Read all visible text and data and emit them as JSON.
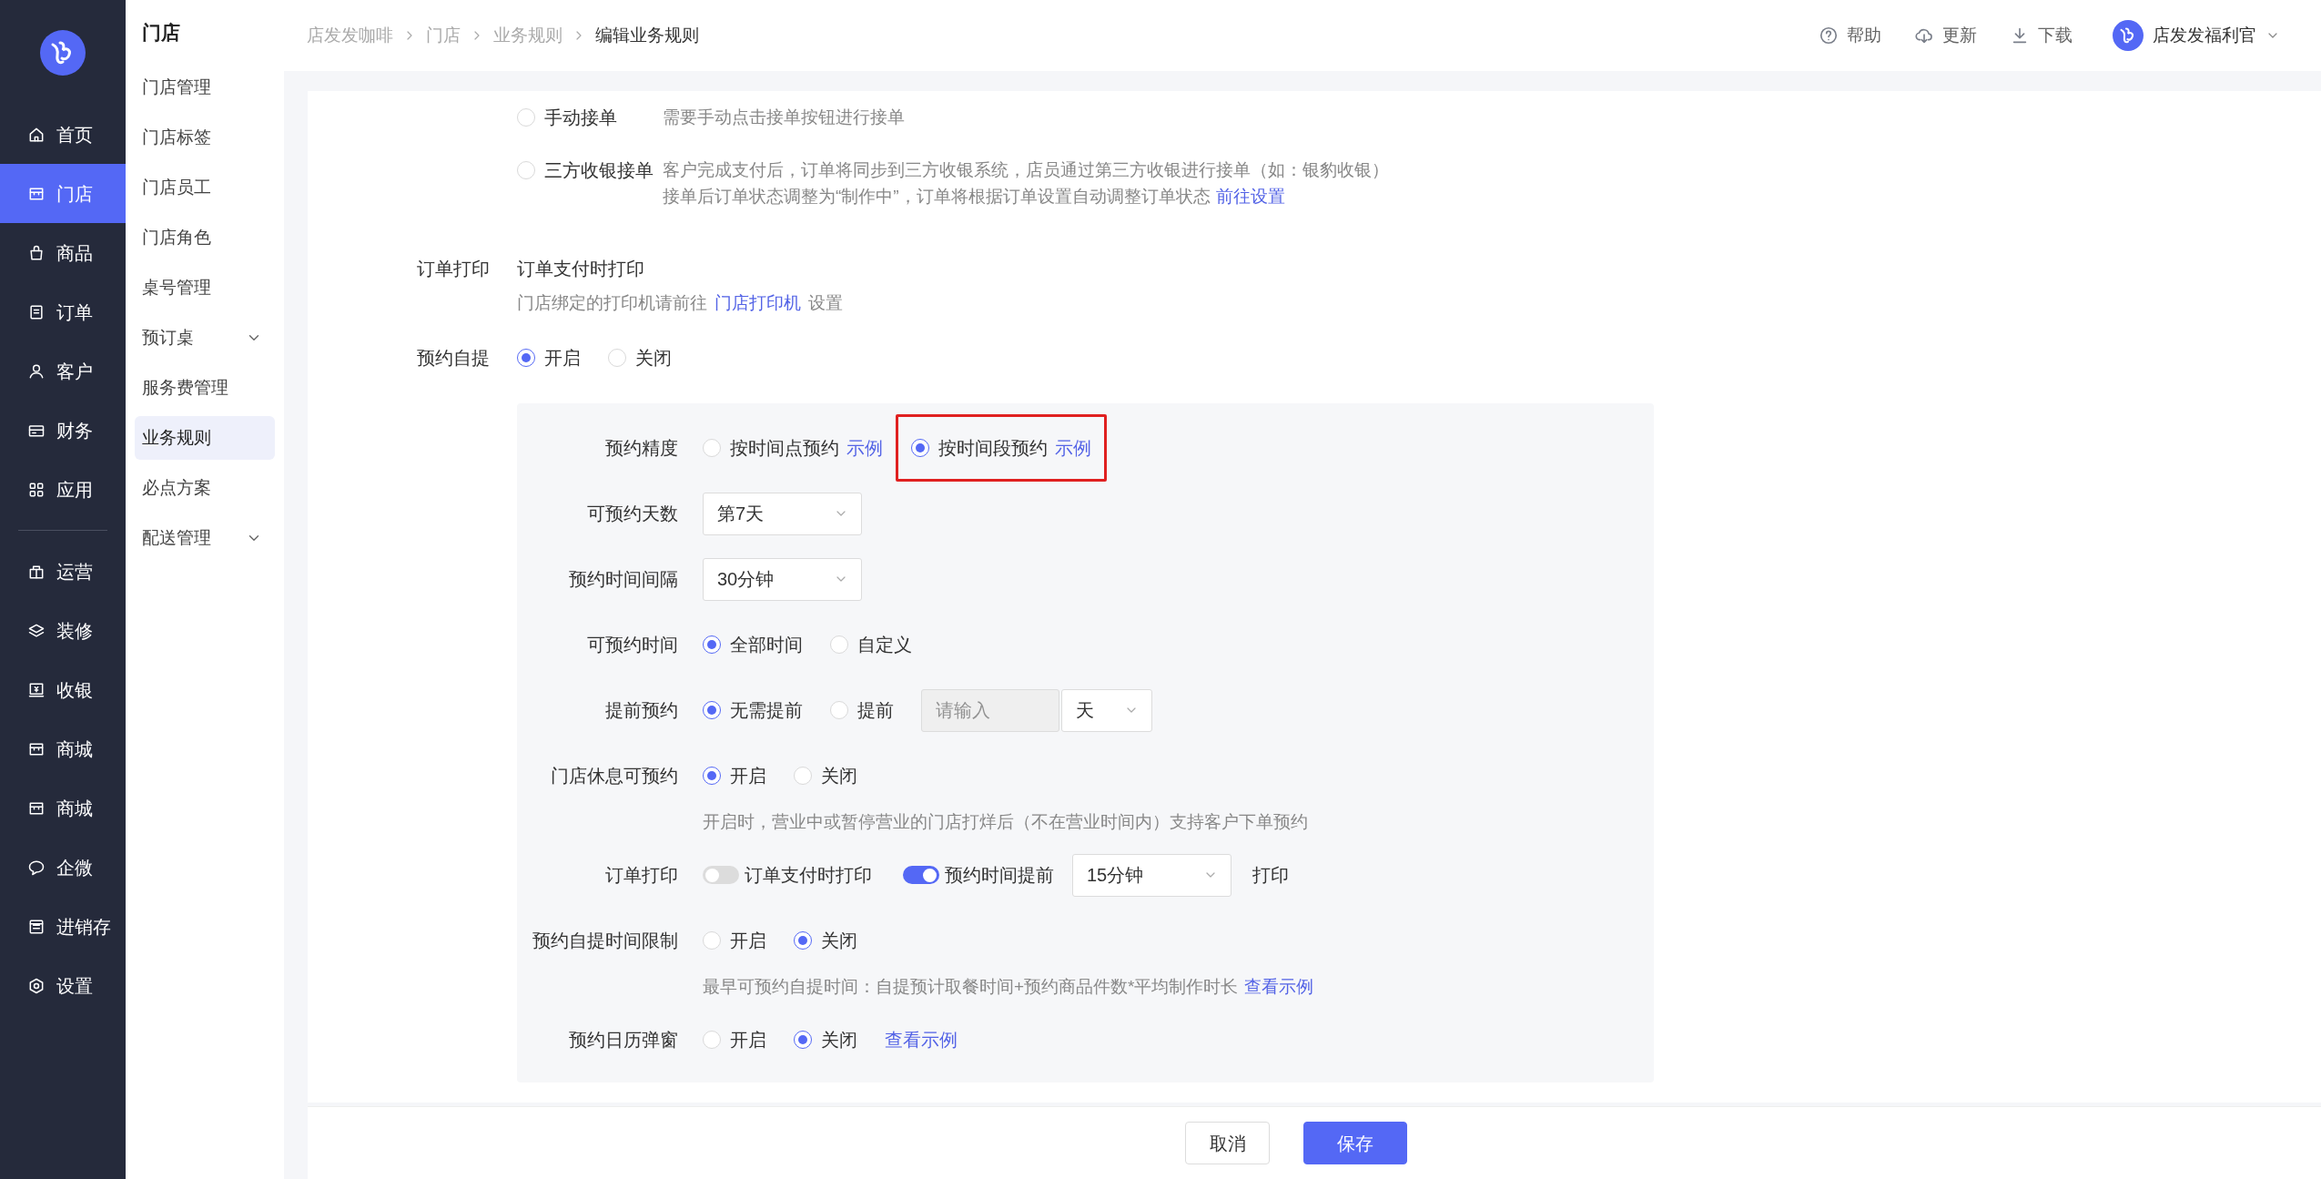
{
  "nav_main": [
    {
      "label": "首页",
      "selected": false
    },
    {
      "label": "门店",
      "selected": true
    },
    {
      "label": "商品",
      "selected": false
    },
    {
      "label": "订单",
      "selected": false
    },
    {
      "label": "客户",
      "selected": false
    },
    {
      "label": "财务",
      "selected": false
    },
    {
      "label": "应用",
      "selected": false
    }
  ],
  "nav_more": [
    {
      "label": "运营",
      "selected": false
    },
    {
      "label": "装修",
      "selected": false
    },
    {
      "label": "收银",
      "selected": false
    },
    {
      "label": "商城",
      "selected": false
    },
    {
      "label": "商城",
      "selected": false
    },
    {
      "label": "企微",
      "selected": false
    },
    {
      "label": "进销存",
      "selected": false
    },
    {
      "label": "设置",
      "selected": false
    }
  ],
  "submenu": {
    "title": "门店",
    "items": [
      {
        "label": "门店管理",
        "kind": "link",
        "selected": false
      },
      {
        "label": "门店标签",
        "kind": "link",
        "selected": false
      },
      {
        "label": "门店员工",
        "kind": "link",
        "selected": false
      },
      {
        "label": "门店角色",
        "kind": "link",
        "selected": false
      },
      {
        "label": "桌号管理",
        "kind": "link",
        "selected": false
      },
      {
        "label": "预订桌",
        "kind": "group",
        "expanded": false,
        "selected": false
      },
      {
        "label": "服务费管理",
        "kind": "link",
        "selected": false
      },
      {
        "label": "业务规则",
        "kind": "link",
        "selected": true
      },
      {
        "label": "必点方案",
        "kind": "link",
        "selected": false
      },
      {
        "label": "配送管理",
        "kind": "group",
        "expanded": false,
        "selected": false
      }
    ]
  },
  "breadcrumb": [
    "店发发咖啡",
    "门店",
    "业务规则",
    "编辑业务规则"
  ],
  "header_actions": [
    {
      "label": "帮助"
    },
    {
      "label": "更新"
    },
    {
      "label": "下载"
    }
  ],
  "user": {
    "name": "店发发福利官"
  },
  "accept_options": [
    {
      "label": "手动接单",
      "selected": false,
      "lines": [
        {
          "text": "需要手动点击接单按钮进行接单"
        }
      ]
    },
    {
      "label": "三方收银接单",
      "selected": false,
      "lines": [
        {
          "text": "客户完成支付后，订单将同步到三方收银系统，店员通过第三方收银进行接单（如：银豹收银）"
        },
        {
          "text": "接单后订单状态调整为“制作中”，订单将根据订单设置自动调整订单状态",
          "link": "前往设置"
        }
      ]
    }
  ],
  "order_print": {
    "label": "订单打印",
    "value": "订单支付时打印",
    "hint": "门店绑定的打印机请前往",
    "hint_link": "门店打印机",
    "hint_suffix": "设置"
  },
  "self_pickup": {
    "label": "预约自提",
    "options": [
      {
        "label": "开启",
        "selected": true
      },
      {
        "label": "关闭",
        "selected": false
      }
    ]
  },
  "panel_rows": [
    {
      "kind": "radio",
      "label": "预约精度",
      "options": [
        {
          "label": "按时间点预约",
          "link": "示例",
          "selected": false,
          "highlighted": false
        },
        {
          "label": "按时间段预约",
          "link": "示例",
          "selected": true,
          "highlighted": true
        }
      ]
    },
    {
      "kind": "select",
      "label": "可预约天数",
      "value": "第7天"
    },
    {
      "kind": "select",
      "label": "预约时间间隔",
      "value": "30分钟"
    },
    {
      "kind": "radio",
      "label": "可预约时间",
      "options": [
        {
          "label": "全部时间",
          "selected": true
        },
        {
          "label": "自定义",
          "selected": false
        }
      ]
    },
    {
      "kind": "advance",
      "label": "提前预约",
      "options": [
        {
          "label": "无需提前",
          "selected": true
        },
        {
          "label": "提前",
          "selected": false
        }
      ],
      "input": {
        "placeholder": "请输入",
        "disabled": true
      },
      "unit": "天"
    },
    {
      "kind": "radio",
      "label": "门店休息可预约",
      "options": [
        {
          "label": "开启",
          "selected": true
        },
        {
          "label": "关闭",
          "selected": false
        }
      ],
      "hint": "开启时，营业中或暂停营业的门店打烊后（不在营业时间内）支持客户下单预约"
    },
    {
      "kind": "print",
      "label": "订单打印",
      "toggles": [
        {
          "label": "订单支付时打印",
          "on": false
        },
        {
          "label": "预约时间提前",
          "on": true
        }
      ],
      "value": "15分钟",
      "suffix": "打印"
    },
    {
      "kind": "radio",
      "label": "预约自提时间限制",
      "options": [
        {
          "label": "开启",
          "selected": false
        },
        {
          "label": "关闭",
          "selected": true
        }
      ],
      "hint": "最早可预约自提时间：自提预计取餐时间+预约商品件数*平均制作时长",
      "hint_link": "查看示例"
    },
    {
      "kind": "radio",
      "label": "预约日历弹窗",
      "options": [
        {
          "label": "开启",
          "selected": false
        },
        {
          "label": "关闭",
          "selected": true
        }
      ],
      "link": "查看示例"
    }
  ],
  "footer_buttons": [
    {
      "label": "取消",
      "kind": "secondary"
    },
    {
      "label": "保存",
      "kind": "primary"
    }
  ]
}
